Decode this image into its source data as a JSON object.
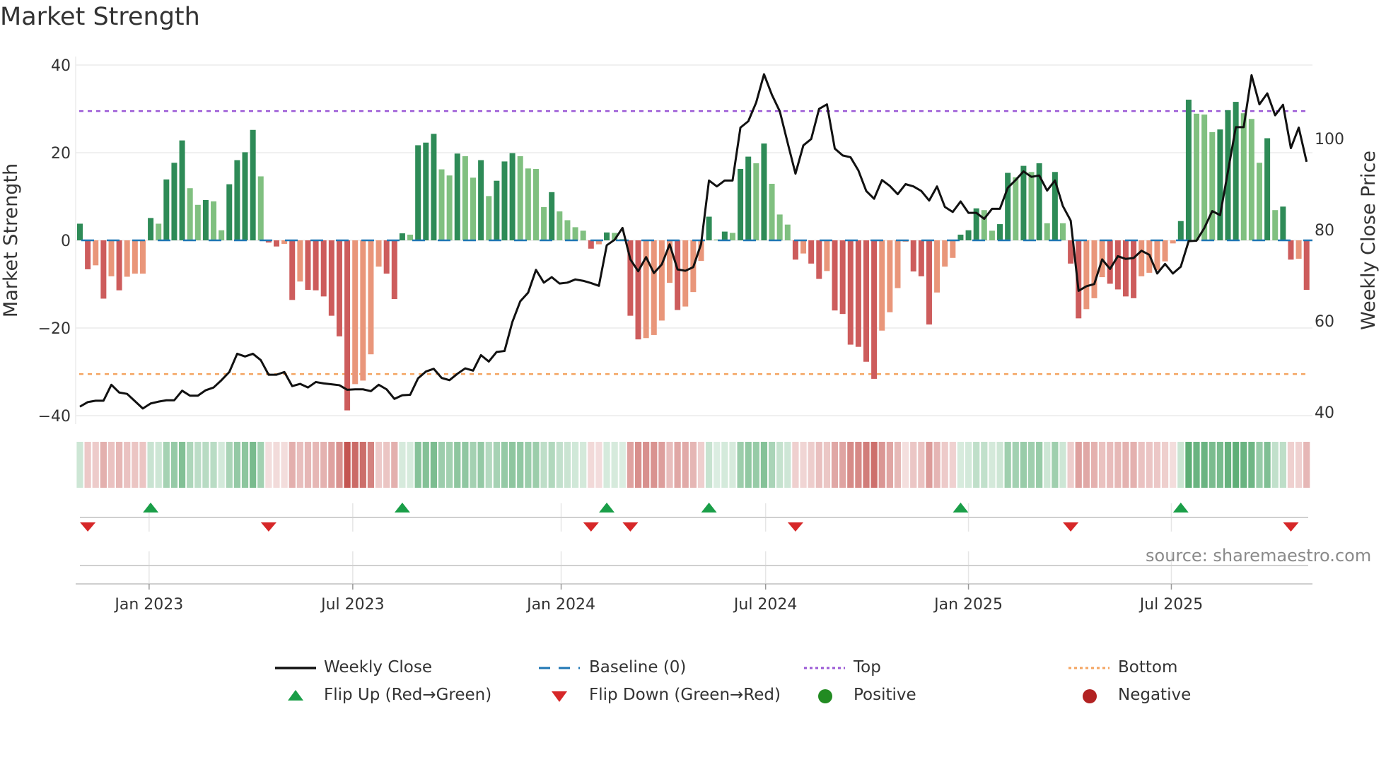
{
  "title": "Market Strength",
  "source": "source: sharemaestro.com",
  "legend": {
    "weekly_close": "Weekly Close",
    "baseline": "Baseline (0)",
    "top": "Top",
    "bottom": "Bottom",
    "flip_up": "Flip Up (Red→Green)",
    "flip_down": "Flip Down (Green→Red)",
    "positive": "Positive",
    "negative": "Negative"
  },
  "colors": {
    "strong_up": "#2e8b57",
    "weak_up": "#80c080",
    "strong_down": "#cd5c5c",
    "weak_down": "#e9967a",
    "baseline": "#1f77b4",
    "top": "#9b59d6",
    "bottom": "#f4a460",
    "flip_up": "#1a9e48",
    "flip_down": "#d62728",
    "positive": "#228b22",
    "negative": "#b22222"
  },
  "chart_data": {
    "type": "bar",
    "title": "Market Strength",
    "ylabel": "Market Strength",
    "y2label": "Weekly Close Price",
    "ylim": [
      -40,
      40
    ],
    "yticks": [
      -40,
      -20,
      0,
      20,
      40
    ],
    "yticklabels": [
      "−40",
      "−20",
      "0",
      "20",
      "40"
    ],
    "y2ticks": [
      40,
      60,
      80,
      100
    ],
    "y2ticklabels": [
      "40",
      "60",
      "80",
      "100"
    ],
    "top_level": 29.5,
    "bottom_level": -30.5,
    "baseline": 0,
    "xticks": [
      {
        "week": 8.8,
        "label": "Jan 2023"
      },
      {
        "week": 34.7,
        "label": "Jul 2023"
      },
      {
        "week": 61.2,
        "label": "Jan 2024"
      },
      {
        "week": 87.2,
        "label": "Jul 2024"
      },
      {
        "week": 113.0,
        "label": "Jan 2025"
      },
      {
        "week": 138.8,
        "label": "Jul 2025"
      }
    ],
    "series": [
      {
        "name": "Market Strength",
        "values": [
          3.8,
          -6.6,
          -5.7,
          -13.3,
          -8.2,
          -11.4,
          -8.3,
          -7.6,
          -7.6,
          5.1,
          3.8,
          13.9,
          17.7,
          22.8,
          11.9,
          8.1,
          9.2,
          8.9,
          2.3,
          12.8,
          18.3,
          20.1,
          25.2,
          14.6,
          -0.5,
          -1.4,
          -0.8,
          -13.6,
          -9.4,
          -11.3,
          -11.4,
          -12.8,
          -17.2,
          -21.9,
          -38.8,
          -32.8,
          -32,
          -26,
          -6,
          -7.6,
          -13.4,
          1.6,
          1.3,
          21.7,
          22.3,
          24.3,
          16.2,
          14.8,
          19.8,
          19.2,
          14.3,
          18.3,
          10.1,
          13.6,
          18,
          19.9,
          19.2,
          16.4,
          16.3,
          7.6,
          11,
          6.6,
          4.6,
          3,
          2.2,
          -1.9,
          -0.9,
          1.8,
          1.7,
          0.3,
          -17.2,
          -22.6,
          -22.3,
          -21.6,
          -18.3,
          -9.7,
          -15.9,
          -15.1,
          -11.8,
          -4.7,
          5.4,
          0.2,
          2,
          1.7,
          16.3,
          19.1,
          17.6,
          22.1,
          12.9,
          5.9,
          3.6,
          -4.4,
          -3,
          -5.3,
          -8.8,
          -7,
          -16,
          -16.8,
          -23.8,
          -24.3,
          -27.7,
          -31.6,
          -20.6,
          -16.4,
          -10.9,
          -0.3,
          -7.1,
          -8.2,
          -19.2,
          -11.9,
          -6,
          -4,
          1.3,
          2.3,
          7.3,
          6.9,
          2.2,
          3.7,
          15.4,
          14.4,
          17,
          15.6,
          17.6,
          3.9,
          15.6,
          3.9,
          -5.3,
          -17.8,
          -15.7,
          -13.2,
          -8.4,
          -9.9,
          -11.2,
          -12.8,
          -13.2,
          -8.2,
          -7.4,
          -6.8,
          -4.8,
          -0.7,
          4.4,
          32.1,
          28.9,
          28.7,
          24.7,
          25.3,
          29.7,
          31.6,
          29,
          27.7,
          17.7,
          23.3,
          6.9,
          7.7,
          -4.4,
          -4.2,
          -11.3
        ]
      },
      {
        "name": "Weekly Close",
        "axis": "right",
        "values": [
          41.2,
          42.2,
          42.5,
          42.5,
          46,
          44.3,
          44,
          42.4,
          40.8,
          41.9,
          42.3,
          42.6,
          42.6,
          44.7,
          43.6,
          43.6,
          44.8,
          45.4,
          47,
          48.8,
          52.8,
          52.2,
          52.8,
          51.4,
          48.2,
          48.2,
          48.8,
          45.7,
          46.2,
          45.4,
          46.6,
          46.3,
          46.1,
          45.9,
          44.9,
          45,
          45,
          44.6,
          46,
          45,
          42.9,
          43.7,
          43.8,
          47.4,
          48.9,
          49.5,
          47.5,
          47,
          48.4,
          49.6,
          49.1,
          52.5,
          51.1,
          53.2,
          53.4,
          59.8,
          64.3,
          66.2,
          71.2,
          68.4,
          69.6,
          68.2,
          68.4,
          69.1,
          68.8,
          68.3,
          67.7,
          76.6,
          77.8,
          80.4,
          73.5,
          70.9,
          74,
          70.5,
          72.4,
          76.8,
          71.3,
          71,
          71.8,
          76.9,
          90.8,
          89.5,
          90.8,
          90.8,
          102.4,
          103.8,
          107.9,
          114.1,
          109.6,
          106,
          99.1,
          92.3,
          98.5,
          99.9,
          106.5,
          107.5,
          97.8,
          96.3,
          95.9,
          93,
          88.5,
          86.8,
          90.9,
          89.6,
          87.8,
          90,
          89.5,
          88.5,
          86.4,
          89.5,
          85,
          83.9,
          86.2,
          83.7,
          83.7,
          82.4,
          84.6,
          84.6,
          89.2,
          90.9,
          92.8,
          91.6,
          91.9,
          88.6,
          90.8,
          85.2,
          82,
          66.6,
          67.6,
          68.1,
          73.5,
          71.4,
          74.2,
          73.6,
          73.8,
          75.4,
          74.5,
          70.4,
          72.5,
          70.4,
          71.9,
          77.5,
          77.6,
          80.4,
          84.1,
          83.2,
          92.8,
          102.5,
          102.5,
          113.9,
          107.5,
          109.9,
          105.1,
          107.4,
          97.9,
          102.4,
          94.9
        ]
      }
    ]
  }
}
